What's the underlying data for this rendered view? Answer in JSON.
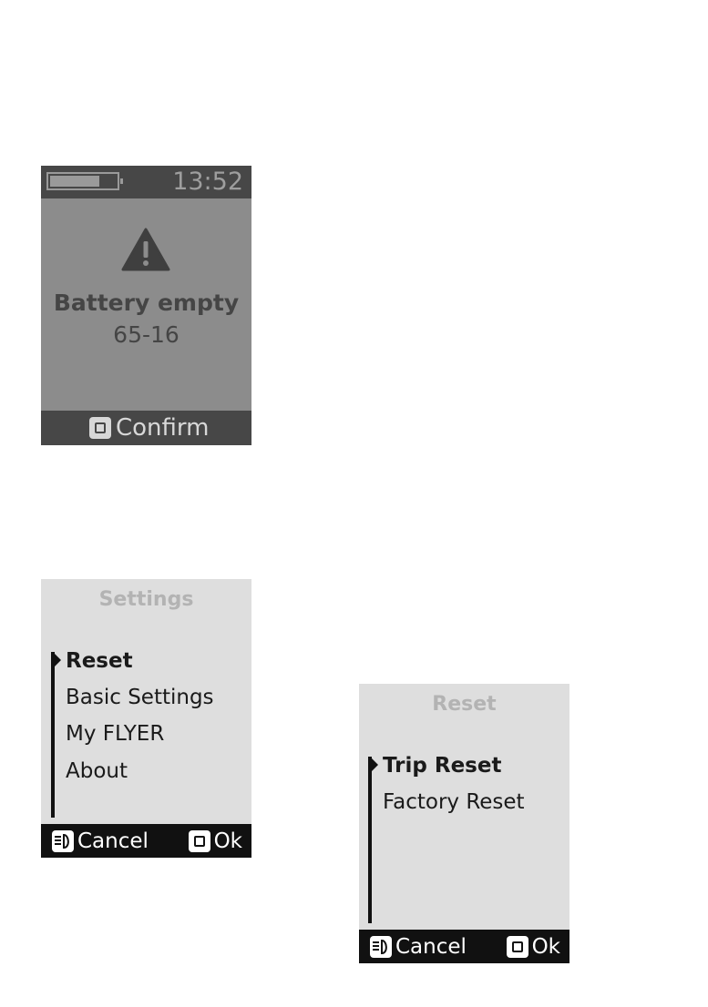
{
  "battery_warning": {
    "clock": "13:52",
    "battery_level": 0.75,
    "icon": "warning-triangle-icon",
    "message": "Battery empty",
    "code": "65-16",
    "confirm_label": "Confirm",
    "confirm_icon": "ok-key-icon"
  },
  "settings_menu": {
    "title": "Settings",
    "items": [
      {
        "label": "Reset",
        "selected": true
      },
      {
        "label": "Basic Settings",
        "selected": false
      },
      {
        "label": "My FLYER",
        "selected": false
      },
      {
        "label": "About",
        "selected": false
      }
    ],
    "cancel_label": "Cancel",
    "cancel_icon": "light-key-icon",
    "ok_label": "Ok",
    "ok_icon": "ok-key-icon"
  },
  "reset_menu": {
    "title": "Reset",
    "items": [
      {
        "label": "Trip Reset",
        "selected": true
      },
      {
        "label": "Factory Reset",
        "selected": false
      }
    ],
    "cancel_label": "Cancel",
    "cancel_icon": "light-key-icon",
    "ok_label": "Ok",
    "ok_icon": "ok-key-icon"
  }
}
